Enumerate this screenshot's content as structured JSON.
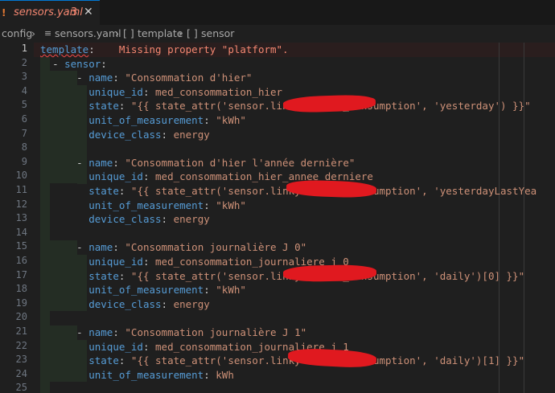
{
  "tab": {
    "filename": "sensors.yaml",
    "problems": "3",
    "icon": "yaml-file-icon",
    "close_icon": "close-icon"
  },
  "breadcrumb": {
    "folder": "config",
    "file": "sensors.yaml",
    "item1": "template",
    "item2": "sensor"
  },
  "editor": {
    "diagnostic": "Missing property \"platform\".",
    "lines": [
      {
        "n": "1",
        "active": true
      },
      {
        "n": "2"
      },
      {
        "n": "3"
      },
      {
        "n": "4"
      },
      {
        "n": "5"
      },
      {
        "n": "6"
      },
      {
        "n": "7"
      },
      {
        "n": "8"
      },
      {
        "n": "9"
      },
      {
        "n": "10"
      },
      {
        "n": "11"
      },
      {
        "n": "12"
      },
      {
        "n": "13"
      },
      {
        "n": "14"
      },
      {
        "n": "15"
      },
      {
        "n": "16"
      },
      {
        "n": "17"
      },
      {
        "n": "18"
      },
      {
        "n": "19"
      },
      {
        "n": "20"
      },
      {
        "n": "21"
      },
      {
        "n": "22"
      },
      {
        "n": "23"
      },
      {
        "n": "24"
      },
      {
        "n": "25"
      }
    ],
    "code": {
      "l1_key": "template",
      "l2_key": "sensor",
      "name": "name",
      "unique_id": "unique_id",
      "state": "state",
      "unit": "unit_of_measurement",
      "device_class": "device_class",
      "l3_val": "\"Consommation d'hier\"",
      "l4_val": "med_consommation_hier",
      "l5_pre": "\"{{ state_attr('sensor.linky",
      "l5_post": "_consumption', 'yesterday') }}\"",
      "l6_val": "\"kWh\"",
      "l7_val": "energy",
      "l9_val": "\"Consommation d'hier l'année dernière\"",
      "l10_val": "med_consommation_hier_annee_derniere",
      "l11_pre": "\"{{ state_attr('sensor.linky",
      "l11_post": "_consumption', 'yesterdayLastYea",
      "l12_val": "\"kWh\"",
      "l13_val": "energy",
      "l15_val": "\"Consommation journalière J 0\"",
      "l16_val": "med_consommation_journaliere_j_0",
      "l17_pre": "\"{{ state_attr('sensor.linky",
      "l17_post": "_consumption', 'daily')[0] }}\"",
      "l18_val": "\"kWh\"",
      "l19_val": "energy",
      "l21_val": "\"Consommation journalière J 1\"",
      "l22_val": "med_consommation_journaliere_j_1",
      "l23_pre": "\"{{ state_attr('sensor.linky",
      "l23_post": "_consumption', 'daily')[1] }}\"",
      "l24_val": "kWh"
    }
  },
  "colors": {
    "key": "#569cd6",
    "string": "#ce9178",
    "error": "#f48771",
    "redaction": "#e0191f"
  }
}
